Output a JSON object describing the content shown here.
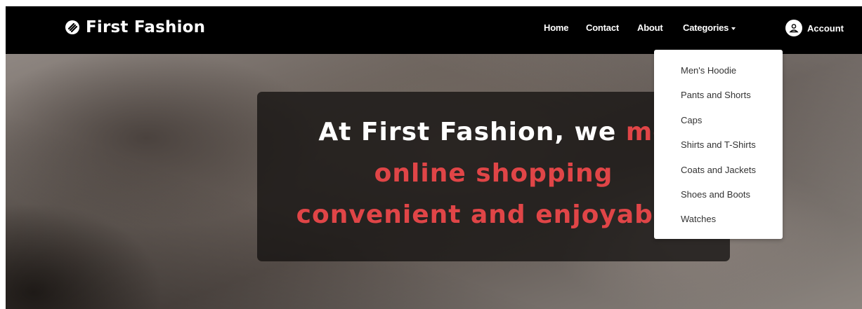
{
  "brand": {
    "name": "First Fashion",
    "icon": "logo-icon"
  },
  "nav": {
    "home": "Home",
    "contact": "Contact",
    "about": "About",
    "categories": "Categories",
    "account": "Account"
  },
  "dropdown": {
    "items": [
      "Men's Hoodie",
      "Pants and Shorts",
      "Caps",
      "Shirts and T-Shirts",
      "Coats and Jackets",
      "Shoes and Boots",
      "Watches"
    ]
  },
  "hero": {
    "line1_white": "At First Fashion, we ",
    "line1_accent": "mc",
    "line2": "online shopping",
    "line3": "convenient and enjoyable."
  },
  "colors": {
    "navbar": "#000000",
    "accent": "#e04547",
    "dropdown_text": "#333333"
  }
}
